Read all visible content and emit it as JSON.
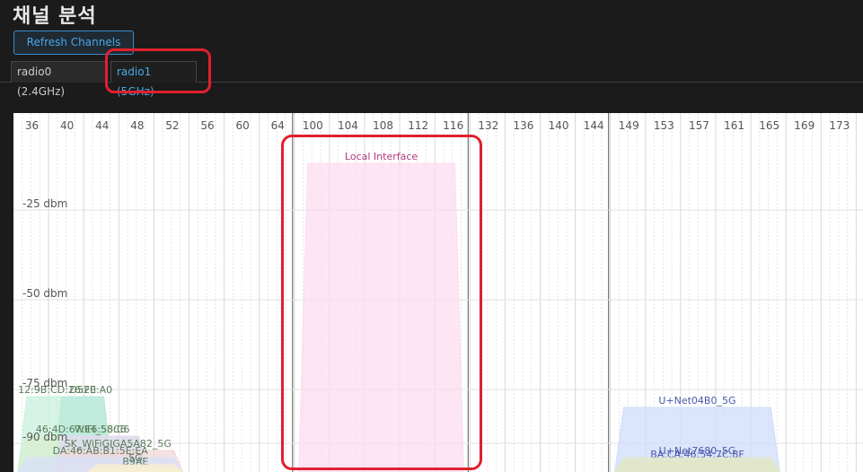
{
  "page": {
    "title": "채널 분석"
  },
  "toolbar": {
    "refresh_label": "Refresh Channels"
  },
  "tabs": [
    {
      "label": "radio0 (2.4GHz)",
      "active": false
    },
    {
      "label": "radio1 (5GHz)",
      "active": true
    }
  ],
  "colors": {
    "accent": "#4aa8e8",
    "highlight": "#e0202e",
    "background": "#1b1b1b"
  },
  "chart_data": {
    "type": "area",
    "title": "",
    "x_ticks": [
      "36",
      "40",
      "44",
      "48",
      "52",
      "56",
      "60",
      "64",
      "100",
      "104",
      "108",
      "112",
      "116",
      "132",
      "136",
      "140",
      "144",
      "149",
      "153",
      "157",
      "161",
      "165",
      "169",
      "173"
    ],
    "y_ticks": [
      {
        "label": "-25 dbm",
        "value": -25
      },
      {
        "label": "-50 dbm",
        "value": -50
      },
      {
        "label": "-75 dbm",
        "value": -75
      },
      {
        "label": "-90 dbm",
        "value": -90
      }
    ],
    "grid": true,
    "series": [
      {
        "name": "Local Interface",
        "x_start": "100",
        "x_end": "116",
        "signal_dbm": -12,
        "color": "#fcdcf0"
      },
      {
        "name": "U+Net04B0_5G",
        "x_start": "149",
        "x_end": "165",
        "signal_dbm": -80,
        "color": "#cfdcfa"
      },
      {
        "name": "BA:CA:46:54:7C:8F",
        "x_start": "149",
        "x_end": "165",
        "signal_dbm": -95,
        "color": "#e8e0c0"
      },
      {
        "name": "U+Net7680_5G",
        "x_start": "149",
        "x_end": "165",
        "signal_dbm": -94,
        "color": "#e0e8c8"
      },
      {
        "name": "12:9B:CD:26:F0:A0",
        "x_start": "36",
        "x_end": "44",
        "signal_dbm": -77,
        "color": "#c8f0dc"
      },
      {
        "name": "D52E",
        "x_start": "40",
        "x_end": "44",
        "signal_dbm": -77,
        "color": "#b8e8d8"
      },
      {
        "name": "46:4D:67:E6:58:C6",
        "x_start": "36",
        "x_end": "48",
        "signal_dbm": -88,
        "color": "#d8f0d0"
      },
      {
        "name": "WIFI_58C6",
        "x_start": "40",
        "x_end": "48",
        "signal_dbm": -88,
        "color": "#e0d8f0"
      },
      {
        "name": "SK_WiFiGIGA5A82_5G",
        "x_start": "40",
        "x_end": "52",
        "signal_dbm": -92,
        "color": "#f0d8d8"
      },
      {
        "name": "DA:46:AB:B1:5E:EA",
        "x_start": "36",
        "x_end": "52",
        "signal_dbm": -94,
        "color": "#d8e0f8"
      },
      {
        "name": "B9AE",
        "x_start": "44",
        "x_end": "52",
        "signal_dbm": -97,
        "color": "#f0e8c8"
      },
      {
        "name": "5G",
        "x_start": "44",
        "x_end": "52",
        "signal_dbm": -96,
        "color": "#f8f0d0"
      }
    ]
  }
}
